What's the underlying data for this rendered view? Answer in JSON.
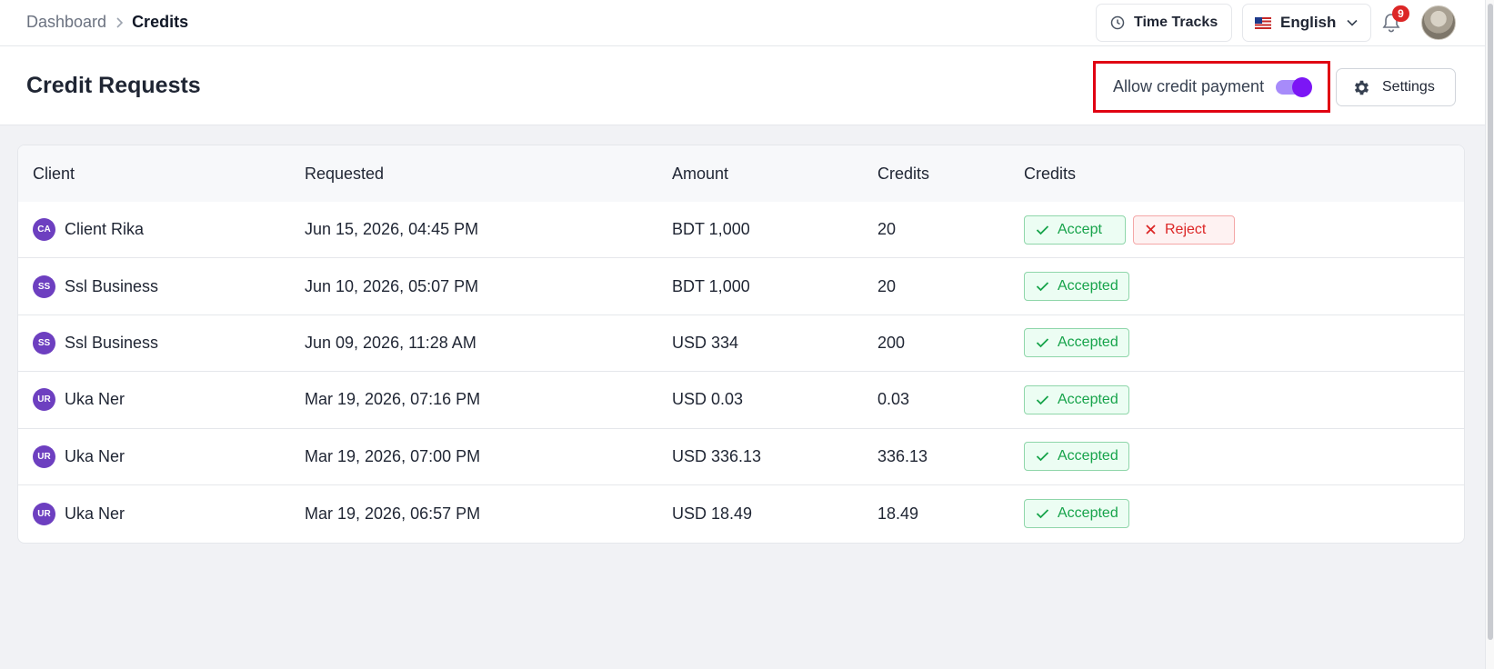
{
  "breadcrumb": {
    "parent": "Dashboard",
    "current": "Credits"
  },
  "topbar": {
    "time_tracks_label": "Time Tracks",
    "language_label": "English",
    "notification_count": "9"
  },
  "header": {
    "title": "Credit Requests",
    "allow_credit_label": "Allow credit payment",
    "allow_credit_enabled": true,
    "settings_label": "Settings"
  },
  "table": {
    "headers": {
      "client": "Client",
      "requested": "Requested",
      "amount": "Amount",
      "credits": "Credits",
      "actions": "Credits"
    },
    "rows": [
      {
        "initials": "CA",
        "client": "Client Rika",
        "requested": "Jun 15, 2026, 04:45 PM",
        "amount": "BDT 1,000",
        "credits": "20",
        "status": "pending",
        "accept_label": "Accept",
        "reject_label": "Reject"
      },
      {
        "initials": "SS",
        "client": "Ssl Business",
        "requested": "Jun 10, 2026, 05:07 PM",
        "amount": "BDT 1,000",
        "credits": "20",
        "status": "accepted",
        "status_label": "Accepted"
      },
      {
        "initials": "SS",
        "client": "Ssl Business",
        "requested": "Jun 09, 2026, 11:28 AM",
        "amount": "USD 334",
        "credits": "200",
        "status": "accepted",
        "status_label": "Accepted"
      },
      {
        "initials": "UR",
        "client": "Uka Ner",
        "requested": "Mar 19, 2026, 07:16 PM",
        "amount": "USD 0.03",
        "credits": "0.03",
        "status": "accepted",
        "status_label": "Accepted"
      },
      {
        "initials": "UR",
        "client": "Uka Ner",
        "requested": "Mar 19, 2026, 07:00 PM",
        "amount": "USD 336.13",
        "credits": "336.13",
        "status": "accepted",
        "status_label": "Accepted"
      },
      {
        "initials": "UR",
        "client": "Uka Ner",
        "requested": "Mar 19, 2026, 06:57 PM",
        "amount": "USD 18.49",
        "credits": "18.49",
        "status": "accepted",
        "status_label": "Accepted"
      }
    ]
  },
  "colors": {
    "accent": "#7c16f5",
    "success": "#16a34a",
    "danger": "#dc2626",
    "highlight_border": "#e00012"
  },
  "icons": {
    "time": "clock-icon",
    "language": "us-flag-icon",
    "notifications": "bell-icon",
    "settings": "gear-icon",
    "accept": "check-icon",
    "reject": "x-icon"
  }
}
